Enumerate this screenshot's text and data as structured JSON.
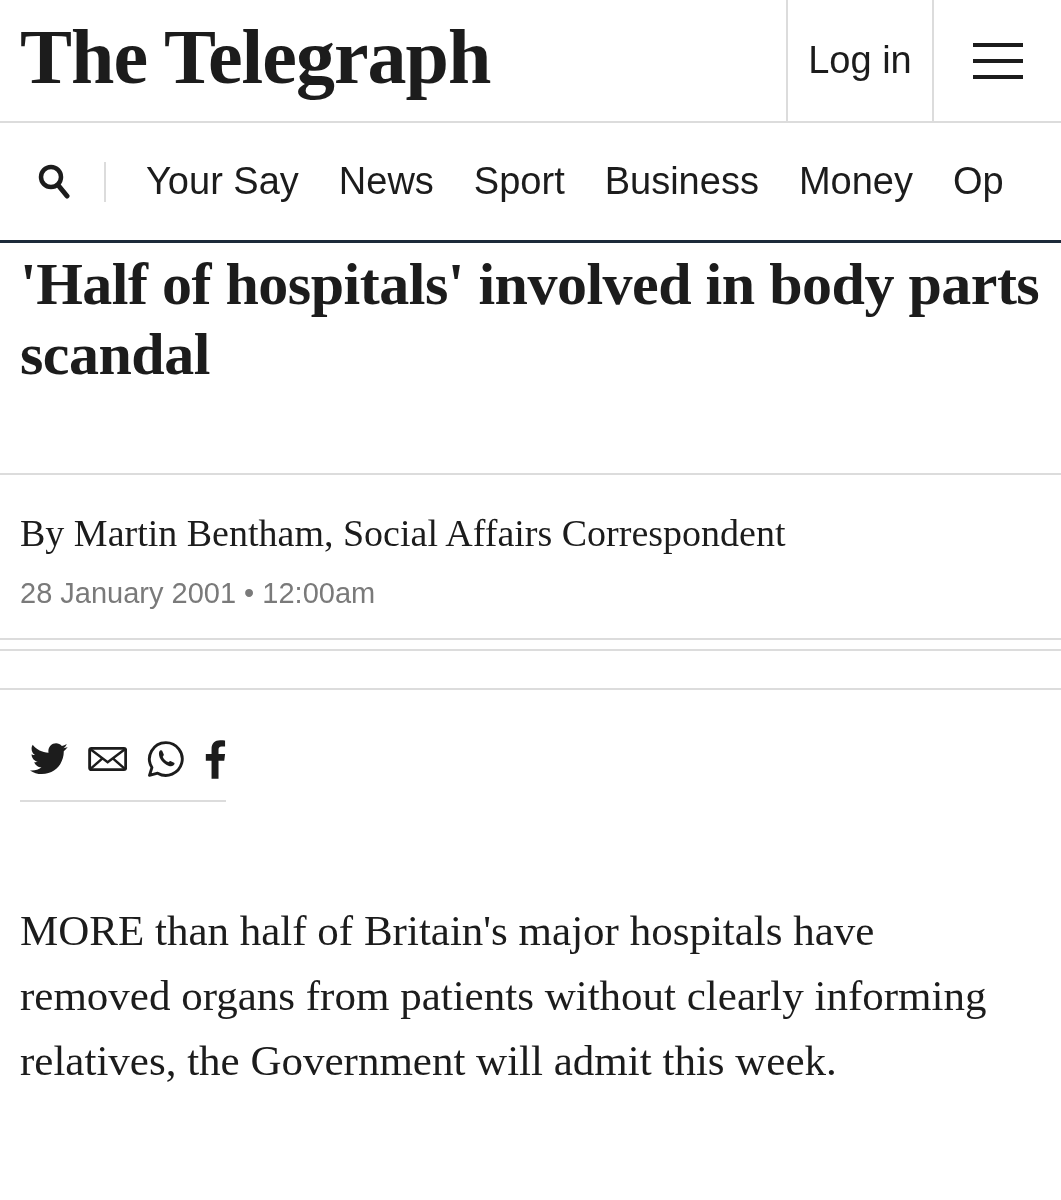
{
  "header": {
    "logo": "The Telegraph",
    "login": "Log in"
  },
  "nav": {
    "items": [
      {
        "label": "Your Say"
      },
      {
        "label": "News"
      },
      {
        "label": "Sport"
      },
      {
        "label": "Business"
      },
      {
        "label": "Money"
      },
      {
        "label": "Op"
      }
    ]
  },
  "article": {
    "headline": "'Half of hospitals' involved in body parts scandal",
    "byline": "By Martin Bentham, Social Affairs Correspondent",
    "date": "28 January 2001",
    "separator": "•",
    "time": "12:00am",
    "body": "MORE than half of Britain's major hospitals have removed organs from patients without clearly informing relatives, the Government will admit this week."
  }
}
